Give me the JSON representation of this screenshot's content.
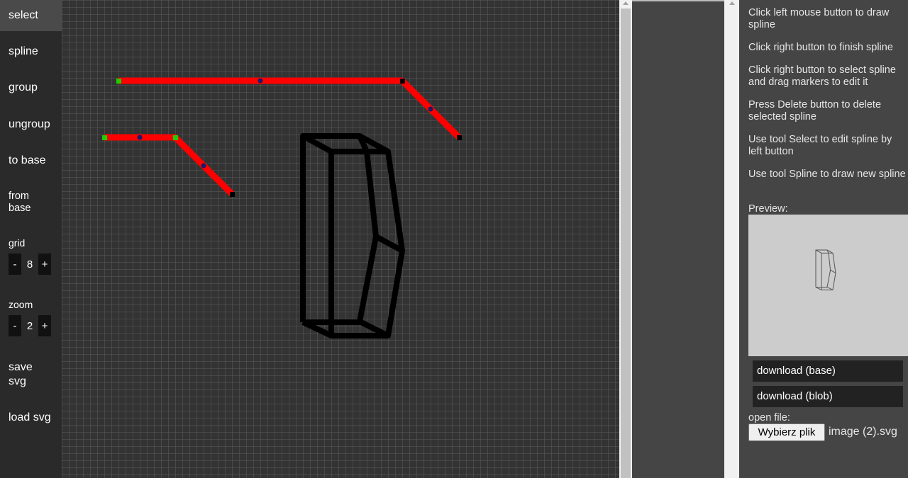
{
  "toolbar": {
    "select": "select",
    "spline": "spline",
    "group": "group",
    "ungroup": "ungroup",
    "to_base": "to base",
    "from_base_1": "from",
    "from_base_2": "base",
    "save_svg_1": "save",
    "save_svg_2": "svg",
    "load_svg": "load svg"
  },
  "grid": {
    "label": "grid",
    "minus": "-",
    "value": "8",
    "plus": "+"
  },
  "zoom": {
    "label": "zoom",
    "minus": "-",
    "value": "2",
    "plus": "+"
  },
  "help": {
    "line1": "Click left mouse button to draw spline",
    "line2": "Click right button to finish spline",
    "line3": "Click right button to select spline and drag markers to edit it",
    "line4": "Press Delete button to delete selected spline",
    "line5": "Use tool Select to edit spline by left button",
    "line6": "Use tool Spline to draw new spline"
  },
  "preview_label": "Preview:",
  "download_base": "download (base)",
  "download_blob": "download (blob)",
  "open_file_label": "open file:",
  "file_button": "Wybierz plik",
  "file_name": "image (2).svg",
  "colors": {
    "selected_spline": "#ff0000",
    "start_marker": "#00cc00",
    "end_marker": "#000000",
    "mid_marker": "#1a1a66",
    "shape": "#000000"
  }
}
